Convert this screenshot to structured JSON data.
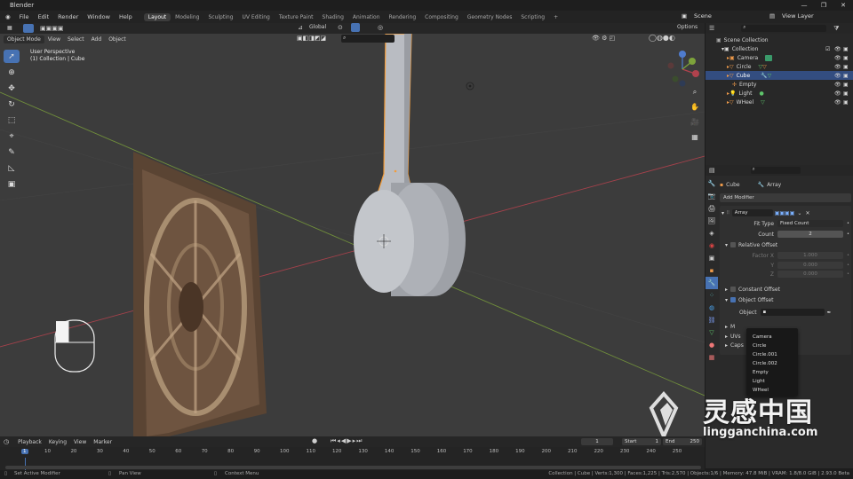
{
  "window": {
    "title": "Blender",
    "controls": [
      "—",
      "❐",
      "✕"
    ]
  },
  "menu": {
    "items": [
      "File",
      "Edit",
      "Render",
      "Window",
      "Help"
    ],
    "workspaces": [
      "Layout",
      "Modeling",
      "Sculpting",
      "UV Editing",
      "Texture Paint",
      "Shading",
      "Animation",
      "Rendering",
      "Compositing",
      "Geometry Nodes",
      "Scripting"
    ],
    "add": "+",
    "scene": "Scene",
    "view_layer": "View Layer"
  },
  "viewport": {
    "mode": "Object Mode",
    "menus": [
      "View",
      "Select",
      "Add",
      "Object"
    ],
    "transform": "Global",
    "options": "Options",
    "info_line1": "User Perspective",
    "info_line2": "(1) Collection | Cube"
  },
  "outliner": {
    "root": "Scene Collection",
    "collection": "Collection",
    "objects": [
      {
        "name": "Camera"
      },
      {
        "name": "Circle"
      },
      {
        "name": "Cube"
      },
      {
        "name": "Empty"
      },
      {
        "name": "Light"
      },
      {
        "name": "WHeel"
      }
    ]
  },
  "properties": {
    "object": "Cube",
    "modifier": "Array",
    "add_modifier": "Add Modifier",
    "modifier_name": "Array",
    "fit_type_label": "Fit Type",
    "fit_type": "Fixed Count",
    "count_label": "Count",
    "count": "2",
    "relative_offset": "Relative Offset",
    "factor_x_label": "Factor X",
    "factor_x": "1.000",
    "y_label": "Y",
    "y": "0.000",
    "z_label": "Z",
    "z": "0.000",
    "constant_offset": "Constant Offset",
    "object_offset": "Object Offset",
    "object_label": "Object",
    "partial": [
      "M",
      "UVs",
      "Caps"
    ]
  },
  "dropdown": {
    "items": [
      "Camera",
      "Circle",
      "Circle.001",
      "Circle.002",
      "Empty",
      "Light",
      "WHeel"
    ]
  },
  "timeline": {
    "menus": [
      "Playback",
      "Keying",
      "View",
      "Marker"
    ],
    "current_frame": "1",
    "start_label": "Start",
    "start": "1",
    "end_label": "End",
    "end": "250",
    "ticks": [
      "10",
      "20",
      "30",
      "40",
      "50",
      "60",
      "70",
      "80",
      "90",
      "100",
      "110",
      "120",
      "130",
      "140",
      "150",
      "160",
      "170",
      "180",
      "190",
      "200",
      "210",
      "220",
      "230",
      "240",
      "250"
    ],
    "current_marker": "1"
  },
  "status": {
    "left1": "Set Active Modifier",
    "left2": "Pan View",
    "left3": "Context Menu",
    "right": "Collection | Cube | Verts:1,300 | Faces:1,225 | Tris:2,570 | Objects:1/6 | Memory: 47.8 MiB | VRAM: 1.8/8.0 GiB | 2.93.0 Beta"
  },
  "watermark": {
    "main": "灵感中国",
    "url": "lingganchina.com"
  },
  "colors": {
    "accent": "#4772b3",
    "selection_orange": "#f39c3a",
    "x_axis": "#b0424d",
    "y_axis": "#7da33b"
  }
}
